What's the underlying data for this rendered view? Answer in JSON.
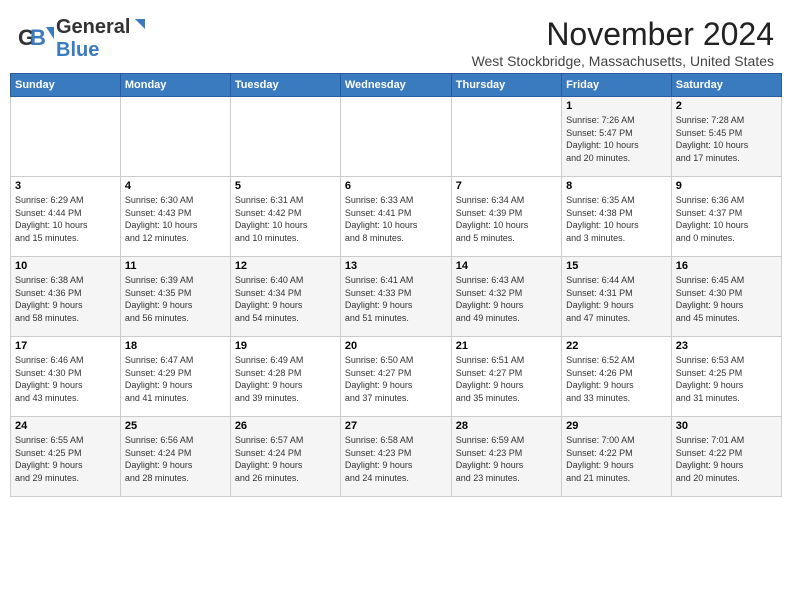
{
  "header": {
    "logo_general": "General",
    "logo_blue": "Blue",
    "month": "November 2024",
    "location": "West Stockbridge, Massachusetts, United States"
  },
  "weekdays": [
    "Sunday",
    "Monday",
    "Tuesday",
    "Wednesday",
    "Thursday",
    "Friday",
    "Saturday"
  ],
  "weeks": [
    [
      {
        "num": "",
        "info": ""
      },
      {
        "num": "",
        "info": ""
      },
      {
        "num": "",
        "info": ""
      },
      {
        "num": "",
        "info": ""
      },
      {
        "num": "",
        "info": ""
      },
      {
        "num": "1",
        "info": "Sunrise: 7:26 AM\nSunset: 5:47 PM\nDaylight: 10 hours\nand 20 minutes."
      },
      {
        "num": "2",
        "info": "Sunrise: 7:28 AM\nSunset: 5:45 PM\nDaylight: 10 hours\nand 17 minutes."
      }
    ],
    [
      {
        "num": "3",
        "info": "Sunrise: 6:29 AM\nSunset: 4:44 PM\nDaylight: 10 hours\nand 15 minutes."
      },
      {
        "num": "4",
        "info": "Sunrise: 6:30 AM\nSunset: 4:43 PM\nDaylight: 10 hours\nand 12 minutes."
      },
      {
        "num": "5",
        "info": "Sunrise: 6:31 AM\nSunset: 4:42 PM\nDaylight: 10 hours\nand 10 minutes."
      },
      {
        "num": "6",
        "info": "Sunrise: 6:33 AM\nSunset: 4:41 PM\nDaylight: 10 hours\nand 8 minutes."
      },
      {
        "num": "7",
        "info": "Sunrise: 6:34 AM\nSunset: 4:39 PM\nDaylight: 10 hours\nand 5 minutes."
      },
      {
        "num": "8",
        "info": "Sunrise: 6:35 AM\nSunset: 4:38 PM\nDaylight: 10 hours\nand 3 minutes."
      },
      {
        "num": "9",
        "info": "Sunrise: 6:36 AM\nSunset: 4:37 PM\nDaylight: 10 hours\nand 0 minutes."
      }
    ],
    [
      {
        "num": "10",
        "info": "Sunrise: 6:38 AM\nSunset: 4:36 PM\nDaylight: 9 hours\nand 58 minutes."
      },
      {
        "num": "11",
        "info": "Sunrise: 6:39 AM\nSunset: 4:35 PM\nDaylight: 9 hours\nand 56 minutes."
      },
      {
        "num": "12",
        "info": "Sunrise: 6:40 AM\nSunset: 4:34 PM\nDaylight: 9 hours\nand 54 minutes."
      },
      {
        "num": "13",
        "info": "Sunrise: 6:41 AM\nSunset: 4:33 PM\nDaylight: 9 hours\nand 51 minutes."
      },
      {
        "num": "14",
        "info": "Sunrise: 6:43 AM\nSunset: 4:32 PM\nDaylight: 9 hours\nand 49 minutes."
      },
      {
        "num": "15",
        "info": "Sunrise: 6:44 AM\nSunset: 4:31 PM\nDaylight: 9 hours\nand 47 minutes."
      },
      {
        "num": "16",
        "info": "Sunrise: 6:45 AM\nSunset: 4:30 PM\nDaylight: 9 hours\nand 45 minutes."
      }
    ],
    [
      {
        "num": "17",
        "info": "Sunrise: 6:46 AM\nSunset: 4:30 PM\nDaylight: 9 hours\nand 43 minutes."
      },
      {
        "num": "18",
        "info": "Sunrise: 6:47 AM\nSunset: 4:29 PM\nDaylight: 9 hours\nand 41 minutes."
      },
      {
        "num": "19",
        "info": "Sunrise: 6:49 AM\nSunset: 4:28 PM\nDaylight: 9 hours\nand 39 minutes."
      },
      {
        "num": "20",
        "info": "Sunrise: 6:50 AM\nSunset: 4:27 PM\nDaylight: 9 hours\nand 37 minutes."
      },
      {
        "num": "21",
        "info": "Sunrise: 6:51 AM\nSunset: 4:27 PM\nDaylight: 9 hours\nand 35 minutes."
      },
      {
        "num": "22",
        "info": "Sunrise: 6:52 AM\nSunset: 4:26 PM\nDaylight: 9 hours\nand 33 minutes."
      },
      {
        "num": "23",
        "info": "Sunrise: 6:53 AM\nSunset: 4:25 PM\nDaylight: 9 hours\nand 31 minutes."
      }
    ],
    [
      {
        "num": "24",
        "info": "Sunrise: 6:55 AM\nSunset: 4:25 PM\nDaylight: 9 hours\nand 29 minutes."
      },
      {
        "num": "25",
        "info": "Sunrise: 6:56 AM\nSunset: 4:24 PM\nDaylight: 9 hours\nand 28 minutes."
      },
      {
        "num": "26",
        "info": "Sunrise: 6:57 AM\nSunset: 4:24 PM\nDaylight: 9 hours\nand 26 minutes."
      },
      {
        "num": "27",
        "info": "Sunrise: 6:58 AM\nSunset: 4:23 PM\nDaylight: 9 hours\nand 24 minutes."
      },
      {
        "num": "28",
        "info": "Sunrise: 6:59 AM\nSunset: 4:23 PM\nDaylight: 9 hours\nand 23 minutes."
      },
      {
        "num": "29",
        "info": "Sunrise: 7:00 AM\nSunset: 4:22 PM\nDaylight: 9 hours\nand 21 minutes."
      },
      {
        "num": "30",
        "info": "Sunrise: 7:01 AM\nSunset: 4:22 PM\nDaylight: 9 hours\nand 20 minutes."
      }
    ]
  ]
}
